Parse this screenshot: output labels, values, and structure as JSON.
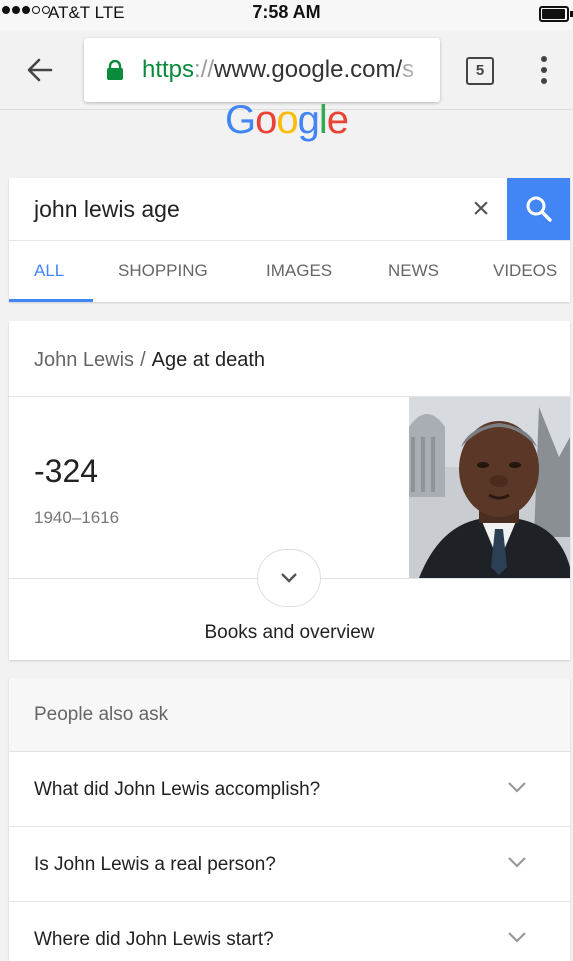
{
  "status_bar": {
    "carrier": "AT&T  LTE",
    "time": "7:58 AM"
  },
  "browser": {
    "url_scheme": "https",
    "url_sep": "://",
    "url_host": "www.google.com/",
    "url_tail": "s",
    "tab_count": "5"
  },
  "logo": {
    "letters": [
      "G",
      "o",
      "o",
      "g",
      "l",
      "e"
    ],
    "colors": [
      "#4285f4",
      "#ea4335",
      "#fbbc05",
      "#4285f4",
      "#34a853",
      "#ea4335"
    ]
  },
  "search": {
    "query": "john lewis age",
    "clear_label": "×"
  },
  "tabs": [
    {
      "label": "ALL",
      "active": true
    },
    {
      "label": "SHOPPING",
      "active": false
    },
    {
      "label": "IMAGES",
      "active": false
    },
    {
      "label": "NEWS",
      "active": false
    },
    {
      "label": "VIDEOS",
      "active": false
    }
  ],
  "knowledge": {
    "entity": "John Lewis",
    "slash": "/",
    "attribute": "Age at death",
    "value": "-324",
    "years": "1940–1616",
    "more_label": "Books and overview"
  },
  "people_also_ask": {
    "title": "People also ask",
    "questions": [
      "What did John Lewis accomplish?",
      "Is John Lewis a real person?",
      "Where did John Lewis start?"
    ]
  },
  "colors": {
    "accent": "#4285f4",
    "secure_green": "#0a8a3b"
  }
}
